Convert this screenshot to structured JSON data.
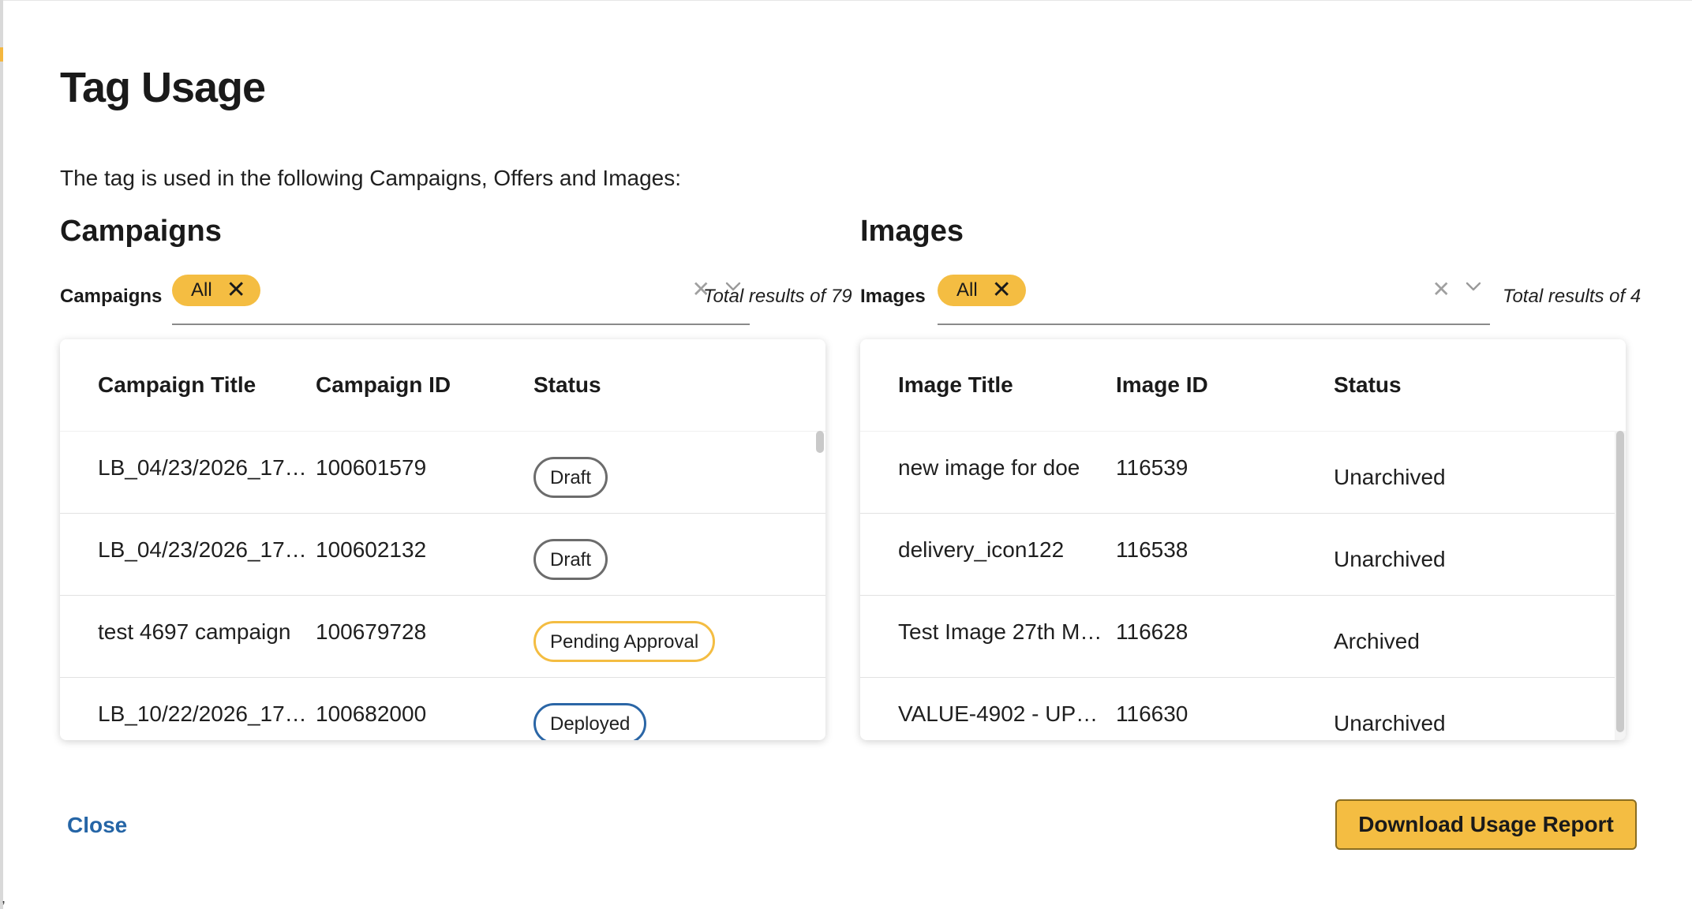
{
  "modal": {
    "title": "Tag Usage",
    "intro": "The tag is used in the following Campaigns, Offers and Images:"
  },
  "campaigns": {
    "heading": "Campaigns",
    "filter_label": "Campaigns",
    "chip_label": "All",
    "total_results": "Total results of 79",
    "columns": [
      "Campaign Title",
      "Campaign ID",
      "Status"
    ],
    "rows": [
      {
        "title": "LB_04/23/2026_17…",
        "id": "100601579",
        "status": "Draft",
        "status_type": "draft"
      },
      {
        "title": "LB_04/23/2026_17…",
        "id": "100602132",
        "status": "Draft",
        "status_type": "draft"
      },
      {
        "title": "test 4697 campaign",
        "id": "100679728",
        "status": "Pending Approval",
        "status_type": "pending"
      },
      {
        "title": "LB_10/22/2026_17…",
        "id": "100682000",
        "status": "Deployed",
        "status_type": "deployed"
      }
    ]
  },
  "images": {
    "heading": "Images",
    "filter_label": "Images",
    "chip_label": "All",
    "total_results": "Total results of 4",
    "columns": [
      "Image Title",
      "Image ID",
      "Status"
    ],
    "rows": [
      {
        "title": "new image for doe",
        "id": "116539",
        "status": "Unarchived"
      },
      {
        "title": "delivery_icon122",
        "id": "116538",
        "status": "Unarchived"
      },
      {
        "title": "Test Image 27th M…",
        "id": "116628",
        "status": "Archived"
      },
      {
        "title": "VALUE-4902 - UP…",
        "id": "116630",
        "status": "Unarchived"
      }
    ]
  },
  "footer": {
    "close_label": "Close",
    "download_label": "Download Usage Report"
  },
  "colors": {
    "accent_yellow": "#f4bd42",
    "link_blue": "#2565a6",
    "deployed_blue": "#2b66a6",
    "draft_gray": "#6c6c6c"
  },
  "icons": {
    "chip_remove": "close-icon",
    "clear": "clear-icon",
    "dropdown": "chevron-down-icon"
  }
}
